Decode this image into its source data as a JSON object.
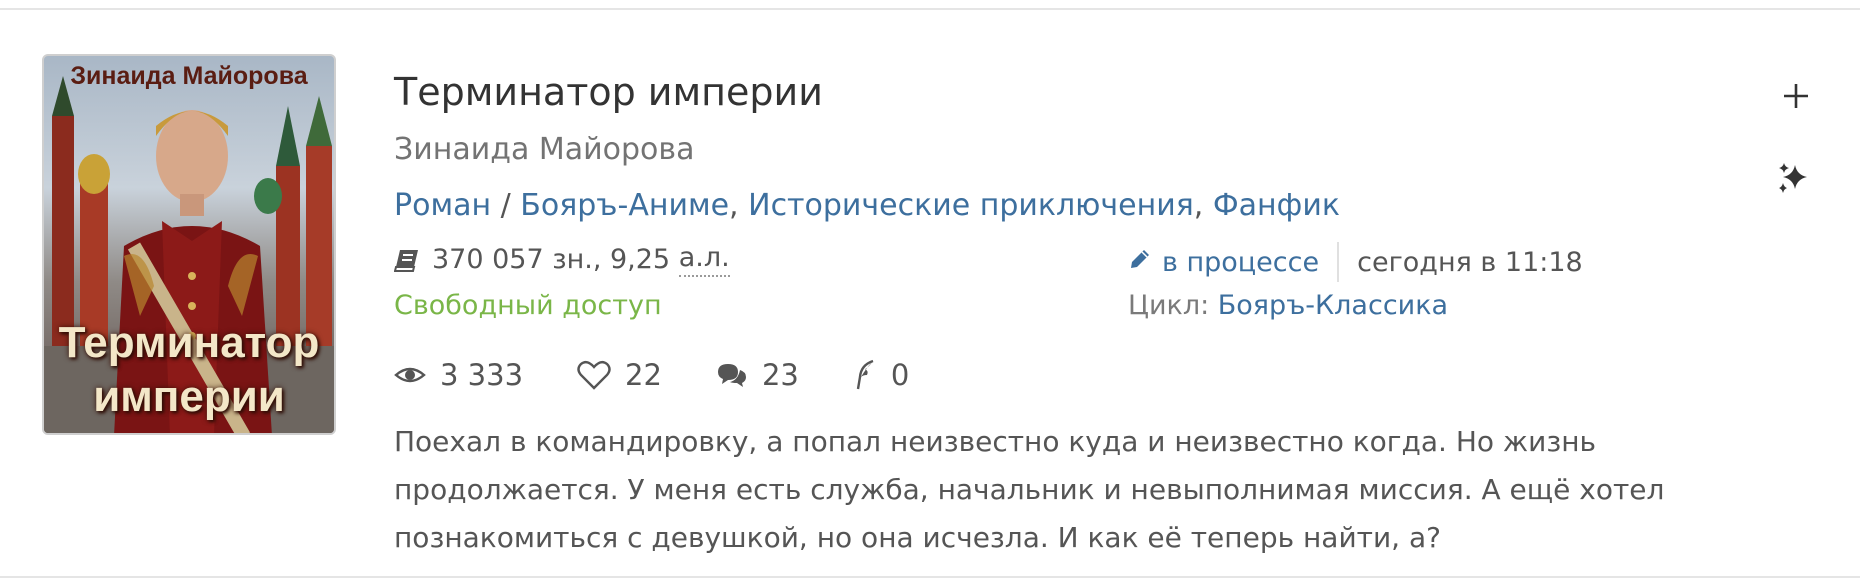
{
  "book": {
    "cover_author": "Зинаида Майорова",
    "cover_title": "Терминатор империи",
    "title": "Терминатор империи",
    "author": "Зинаида Майорова",
    "genre_main": "Роман",
    "genre_sep": " / ",
    "genres": [
      "Бояръ-Аниме",
      "Исторические приключения",
      "Фанфик"
    ],
    "size_chars": "370 057 зн., 9,25",
    "size_unit": "а.л.",
    "access": "Свободный доступ",
    "status": "в процессе",
    "updated": "сегодня в 11:18",
    "cycle_label": "Цикл:",
    "cycle_name": "Бояръ-Классика",
    "annotation": "Поехал в командировку, а попал неизвестно куда и неизвестно когда. Но жизнь продолжается. У меня есть служба, начальник и невыполнимая миссия. А ещё хотел познакомиться с девушкой, но она исчезла. И как её теперь найти, а?"
  },
  "stats": {
    "views": "3 333",
    "likes": "22",
    "comments": "23",
    "awards": "0"
  },
  "icons": {
    "size": "book-icon",
    "status": "pencil-icon",
    "views": "eye-icon",
    "likes": "heart-icon",
    "comments": "comments-icon",
    "awards": "feather-icon",
    "add": "plus-icon",
    "recommend": "sparkle-icon"
  },
  "colors": {
    "link": "#3d6f9e",
    "free": "#7ab648",
    "text": "#333333",
    "muted": "#737373"
  }
}
